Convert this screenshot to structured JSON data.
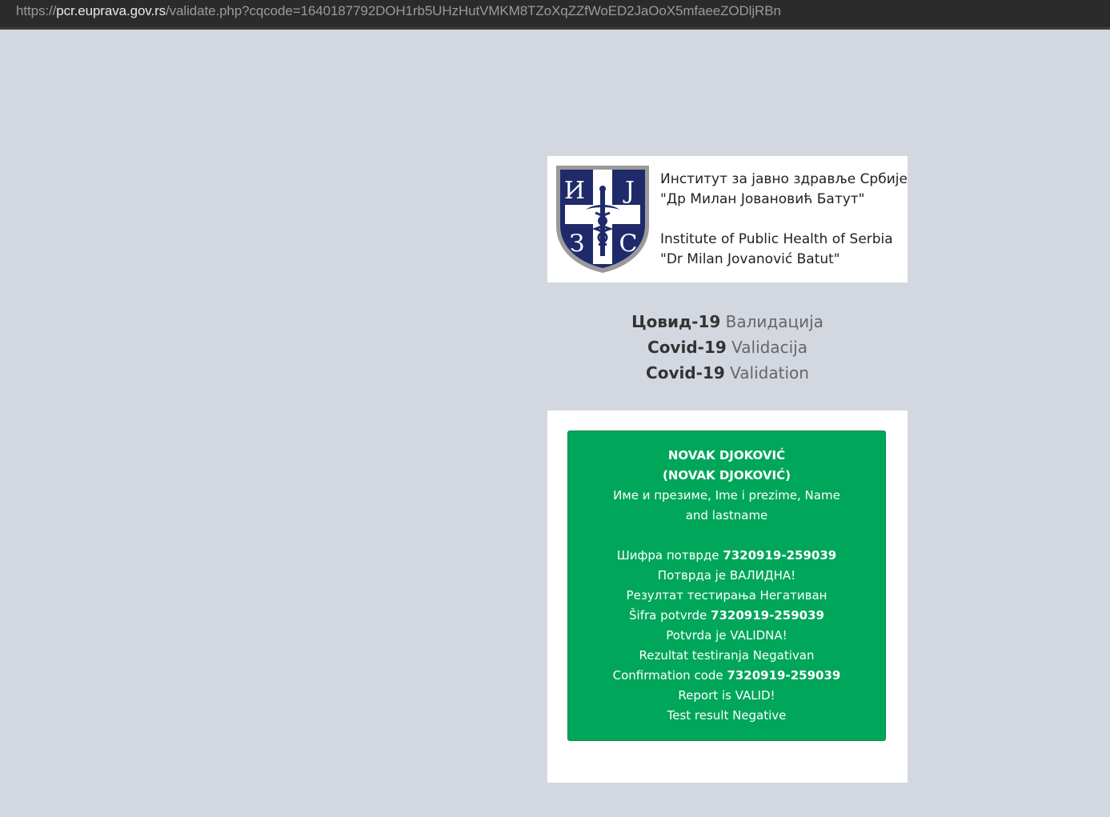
{
  "browser": {
    "url_scheme": "https://",
    "url_host": "pcr.euprava.gov.rs",
    "url_path": "/validate.php?cqcode=1640187792DOH1rb5UHzHutVMKM8TZoXqZZfWoED2JaOoX5mfaeeZODljRBn"
  },
  "logo": {
    "shield_letters": [
      "И",
      "Ј",
      "З",
      "С"
    ],
    "colors": {
      "shield": "#1f2a6b",
      "border": "#a0a0a0",
      "cross": "#ffffff"
    },
    "inst_name_sr_line1": "Институт за јавно здравље Србије",
    "inst_name_sr_line2": "\"Др Милан Јовановић Батут\"",
    "inst_name_en_line1": "Institute of Public Health of Serbia",
    "inst_name_en_line2": "\"Dr Milan Jovanović Batut\""
  },
  "titles": [
    {
      "bold": "Цовид-19",
      "light": "Валидација"
    },
    {
      "bold": "Covid-19",
      "light": "Validacija"
    },
    {
      "bold": "Covid-19",
      "light": "Validation"
    }
  ],
  "result": {
    "name": "NOVAK DJOKOVIĆ",
    "name_paren": "(NOVAK DJOKOVIĆ)",
    "name_label": "Име и презиме, Ime i prezime, Name and lastname",
    "sr_code_label": "Шифра потврде",
    "code": "7320919-259039",
    "sr_valid": "Потврда је ВАЛИДНА!",
    "sr_result": "Резултат тестирања Негативан",
    "lat_code_label": "Šifra potvrde",
    "lat_valid": "Potvrda je VALIDNA!",
    "lat_result": "Rezultat testiranja Negativan",
    "en_code_label": "Confirmation code",
    "en_valid": "Report is VALID!",
    "en_result": "Test result Negative",
    "color": "#00a65a"
  }
}
